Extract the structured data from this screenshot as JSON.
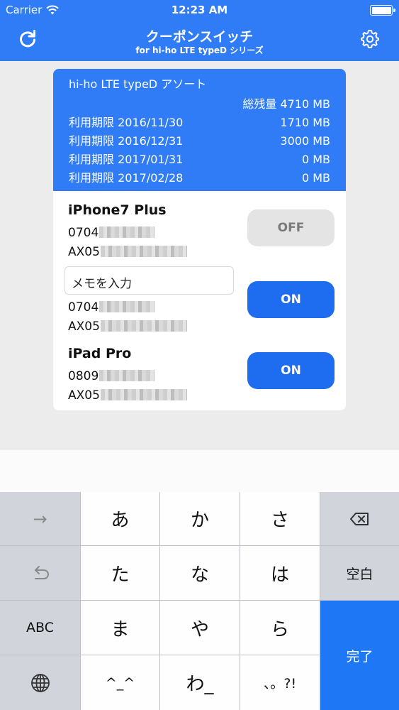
{
  "status_bar": {
    "carrier": "Carrier",
    "time": "12:23 AM"
  },
  "nav": {
    "title": "クーポンスイッチ",
    "subtitle": "for hi-ho LTE typeD シリーズ",
    "left_icon": "refresh-icon",
    "right_icon": "gear-icon"
  },
  "plan": {
    "name": "hi-ho LTE typeD アソート",
    "total": "総残量 4710 MB",
    "expirations": [
      {
        "label": "利用期限 2016/11/30",
        "amount": "1710 MB"
      },
      {
        "label": "利用期限 2016/12/31",
        "amount": "3000 MB"
      },
      {
        "label": "利用期限 2017/01/31",
        "amount": "0  MB"
      },
      {
        "label": "利用期限 2017/02/28",
        "amount": "0  MB"
      }
    ]
  },
  "devices": [
    {
      "name": "iPhone7 Plus",
      "tel_prefix": "0704",
      "iccid_prefix": "AX05",
      "switch": "OFF"
    }
  ],
  "memo": {
    "value": "メモを入力"
  },
  "sim2": {
    "tel_prefix": "0704",
    "iccid_prefix": "AX05",
    "switch": "ON"
  },
  "device3": {
    "name": "iPad Pro",
    "tel_prefix": "0809",
    "iccid_prefix": "AX05",
    "switch": "ON"
  },
  "keyboard": {
    "rows": [
      [
        "→",
        "あ",
        "か",
        "さ",
        "delete-icon"
      ],
      [
        "undo-icon",
        "た",
        "な",
        "は",
        "空白"
      ],
      [
        "ABC",
        "ま",
        "や",
        "ら",
        "完了"
      ],
      [
        "globe-icon",
        "^_^",
        "わ_",
        "、。?!"
      ]
    ],
    "arrow": "→",
    "a": "あ",
    "ka": "か",
    "sa": "さ",
    "ta": "た",
    "na": "な",
    "ha": "は",
    "space": "空白",
    "abc": "ABC",
    "ma": "ま",
    "ya": "や",
    "ra": "ら",
    "done": "完了",
    "emoticon": "^_^",
    "wa": "わ_",
    "punct": "、。?!",
    "accent_color": "#1e78f5"
  },
  "colors": {
    "primary": "#2f7cf6",
    "on": "#1e6cf0",
    "off": "#e4e4e4"
  }
}
